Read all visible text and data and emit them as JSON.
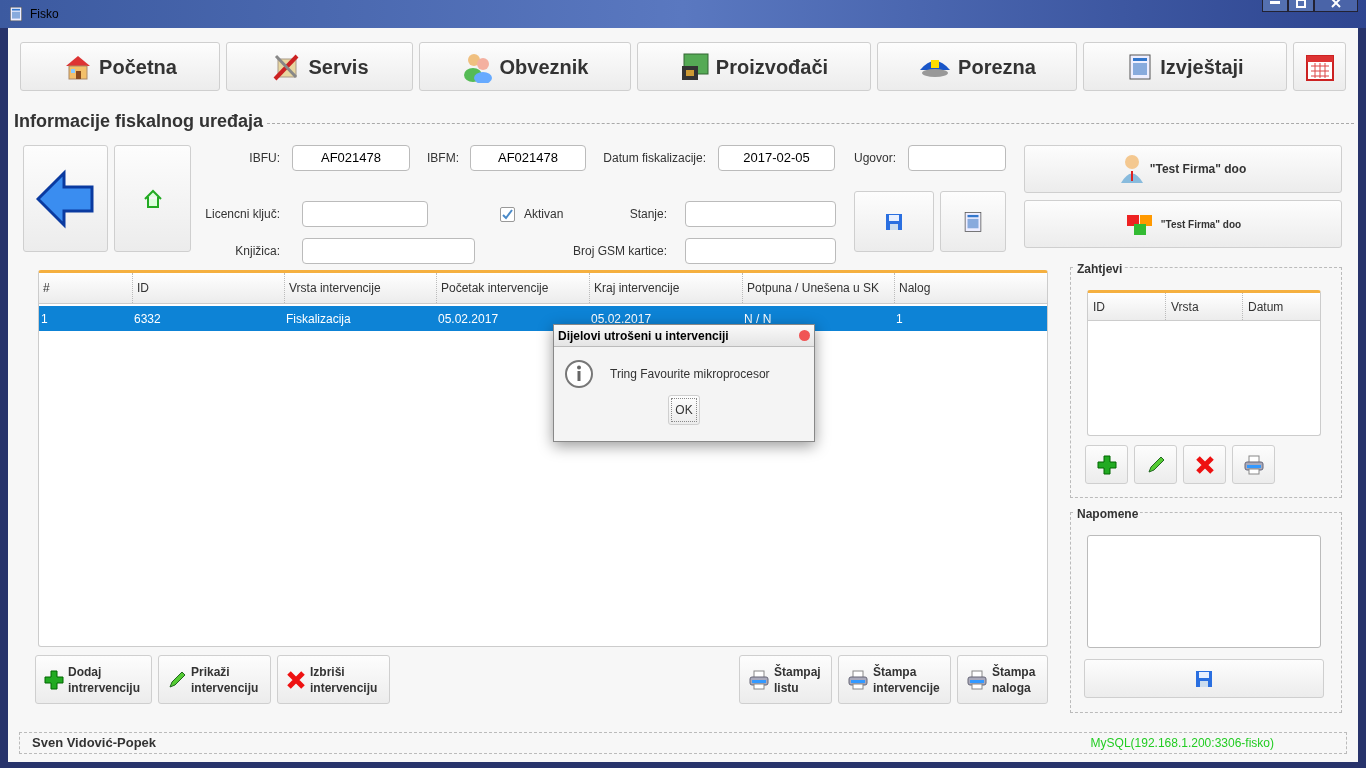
{
  "window": {
    "title": "Fisko"
  },
  "nav": [
    {
      "label": "Početna"
    },
    {
      "label": "Servis"
    },
    {
      "label": "Obveznik"
    },
    {
      "label": "Proizvođači"
    },
    {
      "label": "Porezna"
    },
    {
      "label": "Izvještaji"
    }
  ],
  "section_title": "Informacije fiskalnog uređaja",
  "fields": {
    "ibfu": {
      "label": "IBFU:",
      "value": "AF021478"
    },
    "ibfm": {
      "label": "IBFM:",
      "value": "AF021478"
    },
    "datum": {
      "label": "Datum fiskalizacije:",
      "value": "2017-02-05"
    },
    "ugovor": {
      "label": "Ugovor:"
    },
    "licencni": {
      "label": "Licencni ključ:"
    },
    "knjizica": {
      "label": "Knjižica:"
    },
    "stanje": {
      "label": "Stanje:"
    },
    "gsm": {
      "label": "Broj GSM kartice:"
    }
  },
  "aktivan": {
    "label": "Aktivan",
    "checked": true
  },
  "firm_buttons": [
    "\"Test Firma\" doo",
    "\"Test Firma\" doo"
  ],
  "table": {
    "columns": [
      "#",
      "ID",
      "Vrsta intervencije",
      "Početak intervencije",
      "Kraj intervencije",
      "Potpuna / Unešena u SK",
      "Nalog"
    ],
    "rows": [
      {
        "cells": [
          "1",
          "6332",
          "Fiskalizacija",
          "05.02.2017",
          "05.02.2017",
          "N / N",
          "1"
        ],
        "selected": true
      }
    ]
  },
  "left_actions": [
    [
      "Dodaj",
      "intrervenciju"
    ],
    [
      "Prikaži",
      "intervenciju"
    ],
    [
      "Izbriši",
      "intervenciju"
    ]
  ],
  "print_actions": [
    [
      "Štampaj",
      "listu"
    ],
    [
      "Štampa",
      "intervencije"
    ],
    [
      "Štampa",
      "naloga"
    ]
  ],
  "requests": {
    "title": "Zahtjevi",
    "columns": [
      "ID",
      "Vrsta",
      "Datum"
    ]
  },
  "notes": {
    "title": "Napomene"
  },
  "status_bar": {
    "user": "Sven Vidović-Popek",
    "connection": "MySQL(192.168.1.200:3306-fisko)"
  },
  "dialog": {
    "title": "Dijelovi utrošeni u intervenciji",
    "message": "Tring Favourite mikroprocesor",
    "button": "OK"
  }
}
